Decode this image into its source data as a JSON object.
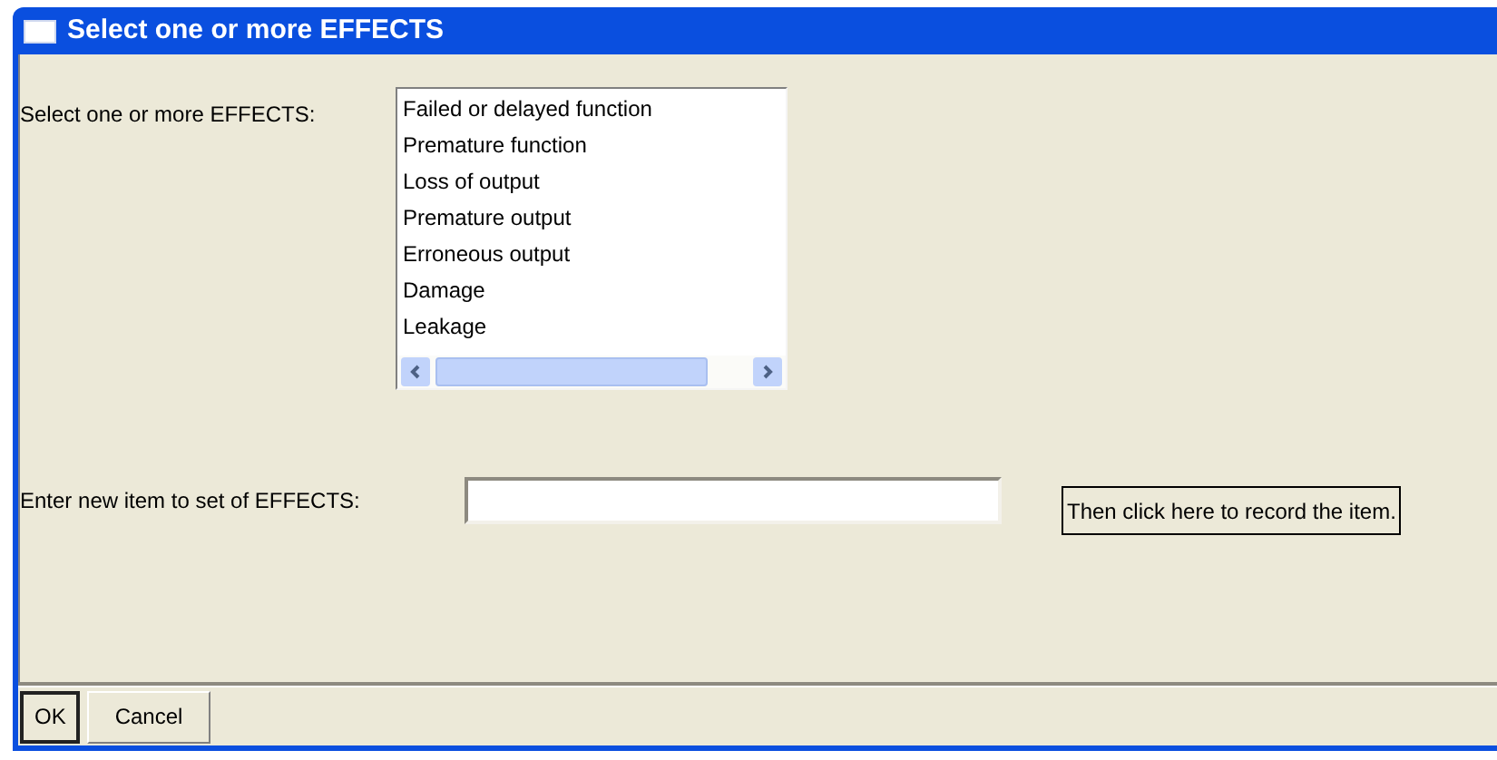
{
  "window": {
    "title": "Select one or more EFFECTS"
  },
  "effects": {
    "label": "Select one or more EFFECTS:",
    "items": [
      "Failed or delayed function",
      "Premature function",
      "Loss of output",
      "Premature output",
      "Erroneous output",
      "Damage",
      "Leakage"
    ]
  },
  "new_item": {
    "label": "Enter new item to set of EFFECTS:",
    "record_button": "Then click here to record the item."
  },
  "buttons": [
    {
      "label": "OK",
      "default": true
    },
    {
      "label": "Cancel",
      "default": false
    }
  ]
}
